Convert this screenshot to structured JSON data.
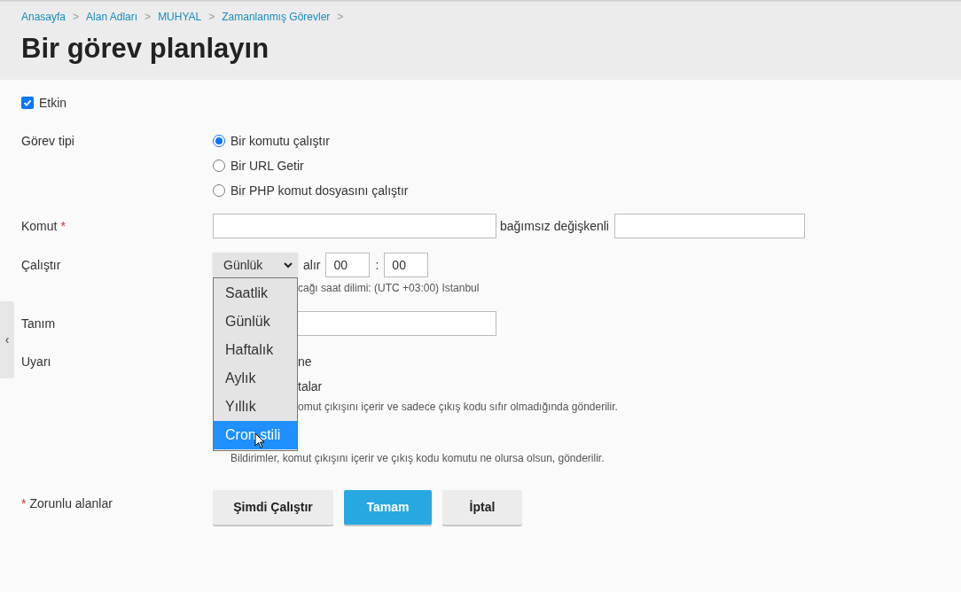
{
  "breadcrumbs": [
    "Anasayfa",
    "Alan Adları",
    "MUHYAL",
    "Zamanlanmış Görevler"
  ],
  "breadcrumb_separator": ">",
  "title": "Bir görev planlayın",
  "enabled": {
    "label": "Etkin",
    "checked": true
  },
  "task_type": {
    "label": "Görev tipi",
    "options": [
      {
        "label": "Bir komutu çalıştır",
        "selected": true
      },
      {
        "label": "Bir URL Getir",
        "selected": false
      },
      {
        "label": "Bir PHP komut dosyasını çalıştır",
        "selected": false
      }
    ]
  },
  "command": {
    "label": "Komut",
    "required_mark": "*",
    "args_label": "bağımsız değişkenli"
  },
  "run": {
    "label": "Çalıştır",
    "select_value": "Günlük",
    "at_label": "alır",
    "hour": "00",
    "separator": ":",
    "minute": "00",
    "hint": "cağı saat dilimi: (UTC +03:00) Istanbul",
    "dropdown": [
      {
        "label": "Saatlik",
        "selected": false
      },
      {
        "label": "Günlük",
        "selected": false
      },
      {
        "label": "Haftalık",
        "selected": false
      },
      {
        "label": "Aylık",
        "selected": false
      },
      {
        "label": "Yıllık",
        "selected": false
      },
      {
        "label": "Cron stili",
        "selected": true
      }
    ]
  },
  "description": {
    "label": "Tanım"
  },
  "notify": {
    "label": "Uyarı",
    "lines": [
      {
        "kind": "option",
        "text": "ne"
      },
      {
        "kind": "option",
        "text": "talar"
      },
      {
        "kind": "hint",
        "text": "omut çıkışını içerir ve sadece çıkış kodu sıfır olmadığında gönderilir."
      },
      {
        "kind": "gap"
      },
      {
        "kind": "hint_full",
        "text": "Bildirimler, komut çıkışını içerir ve çıkış kodu komutu ne olursa olsun, gönderilir."
      }
    ]
  },
  "required_note": {
    "mark": "*",
    "text": "Zorunlu alanlar"
  },
  "buttons": [
    {
      "label": "Şimdi Çalıştır",
      "kind": "secondary"
    },
    {
      "label": "Tamam",
      "kind": "primary"
    },
    {
      "label": "İptal",
      "kind": "secondary"
    }
  ],
  "side_toggle": "‹"
}
